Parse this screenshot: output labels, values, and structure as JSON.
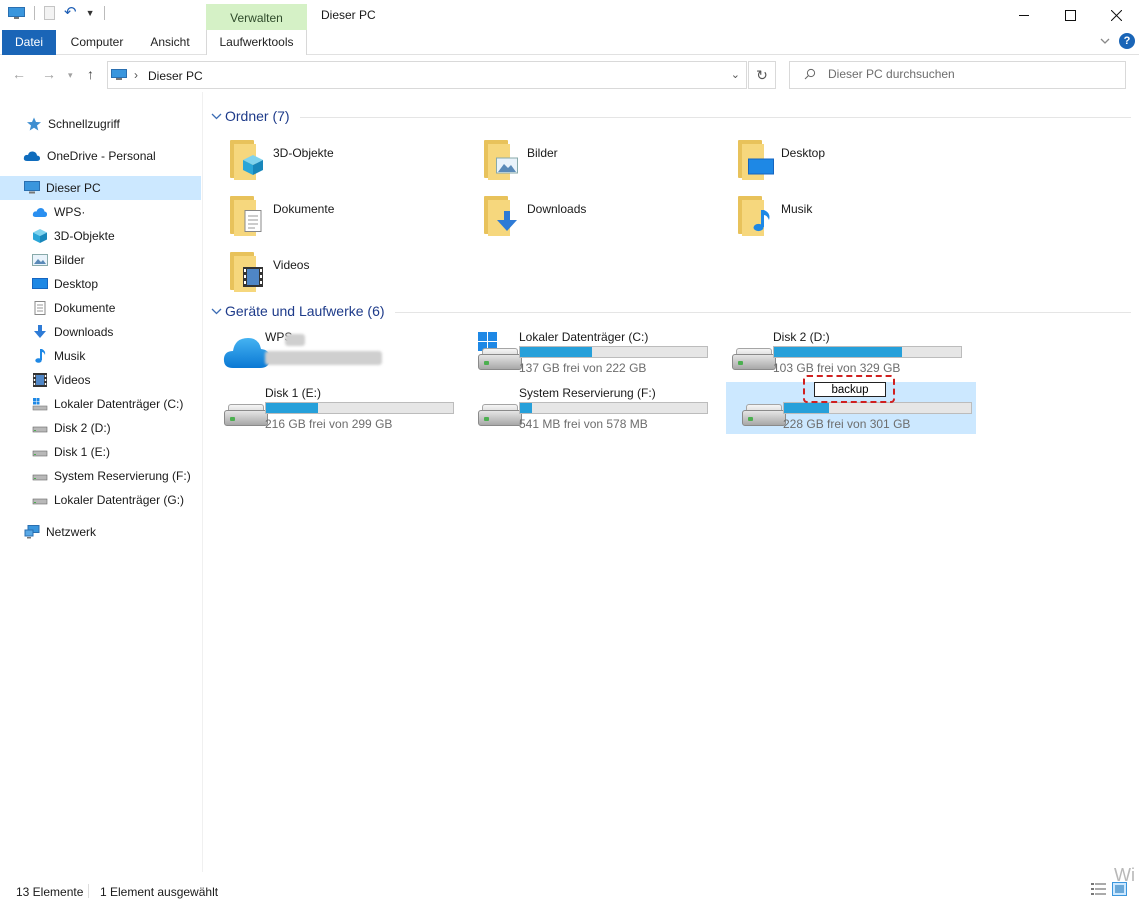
{
  "titlebar": {
    "context_tab": "Verwalten",
    "window_title": "Dieser PC",
    "minimize": "—",
    "maximize": "☐",
    "close": "✕"
  },
  "ribbon": {
    "tabs": [
      "Datei",
      "Computer",
      "Ansicht",
      "Laufwerktools"
    ]
  },
  "address": {
    "path": "Dieser PC",
    "search_placeholder": "Dieser PC durchsuchen"
  },
  "sidebar": {
    "items": [
      {
        "label": "Schnellzugriff",
        "icon": "star-icon"
      },
      {
        "label": "OneDrive - Personal",
        "icon": "cloud-icon"
      },
      {
        "label": "Dieser PC",
        "icon": "computer-icon",
        "selected": true
      },
      {
        "label": "WPS·",
        "icon": "cloud-icon"
      },
      {
        "label": "3D-Objekte",
        "icon": "cube-icon"
      },
      {
        "label": "Bilder",
        "icon": "picture-icon"
      },
      {
        "label": "Desktop",
        "icon": "desktop-icon"
      },
      {
        "label": "Dokumente",
        "icon": "document-icon"
      },
      {
        "label": "Downloads",
        "icon": "download-arrow-icon"
      },
      {
        "label": "Musik",
        "icon": "music-note-icon"
      },
      {
        "label": "Videos",
        "icon": "film-icon"
      },
      {
        "label": "Lokaler Datenträger (C:)",
        "icon": "windows-drive-icon"
      },
      {
        "label": "Disk 2 (D:)",
        "icon": "drive-icon"
      },
      {
        "label": "Disk 1 (E:)",
        "icon": "drive-icon"
      },
      {
        "label": "System Reservierung (F:)",
        "icon": "drive-icon"
      },
      {
        "label": "Lokaler Datenträger (G:)",
        "icon": "drive-icon"
      },
      {
        "label": "Netzwerk",
        "icon": "network-icon"
      }
    ]
  },
  "folders_group": {
    "title": "Ordner (7)",
    "items": [
      {
        "label": "3D-Objekte",
        "badge": "cube-icon"
      },
      {
        "label": "Bilder",
        "badge": "picture-icon"
      },
      {
        "label": "Desktop",
        "badge": "desktop-icon"
      },
      {
        "label": "Dokumente",
        "badge": "document-icon"
      },
      {
        "label": "Downloads",
        "badge": "download-arrow-icon"
      },
      {
        "label": "Musik",
        "badge": "music-note-icon"
      },
      {
        "label": "Videos",
        "badge": "film-icon"
      }
    ]
  },
  "drives_group": {
    "title": "Geräte und Laufwerke (6)",
    "wps": {
      "label": "WPS"
    },
    "drives": [
      {
        "name": "Lokaler Datenträger (C:)",
        "free": "137 GB frei von 222 GB",
        "used_fraction": 0.383
      },
      {
        "name": "Disk 2 (D:)",
        "free": "103 GB frei von 329 GB",
        "used_fraction": 0.687
      },
      {
        "name": "Disk 1 (E:)",
        "free": "216 GB frei von 299 GB",
        "used_fraction": 0.278
      },
      {
        "name": "System Reservierung (F:)",
        "free": "541 MB frei von 578 MB",
        "used_fraction": 0.064
      },
      {
        "rename_value": "backup",
        "free": "228 GB frei von 301 GB",
        "used_fraction": 0.243,
        "selected": true
      }
    ]
  },
  "statusbar": {
    "count": "13 Elemente",
    "selection": "1 Element ausgewählt"
  },
  "watermark": "Wi",
  "colors": {
    "accent": "#1a65b7",
    "selection": "#cce8ff",
    "bar_fill": "#26a0da",
    "context_tab": "#d5f1c6",
    "rename_highlight": "#d01f1f"
  }
}
